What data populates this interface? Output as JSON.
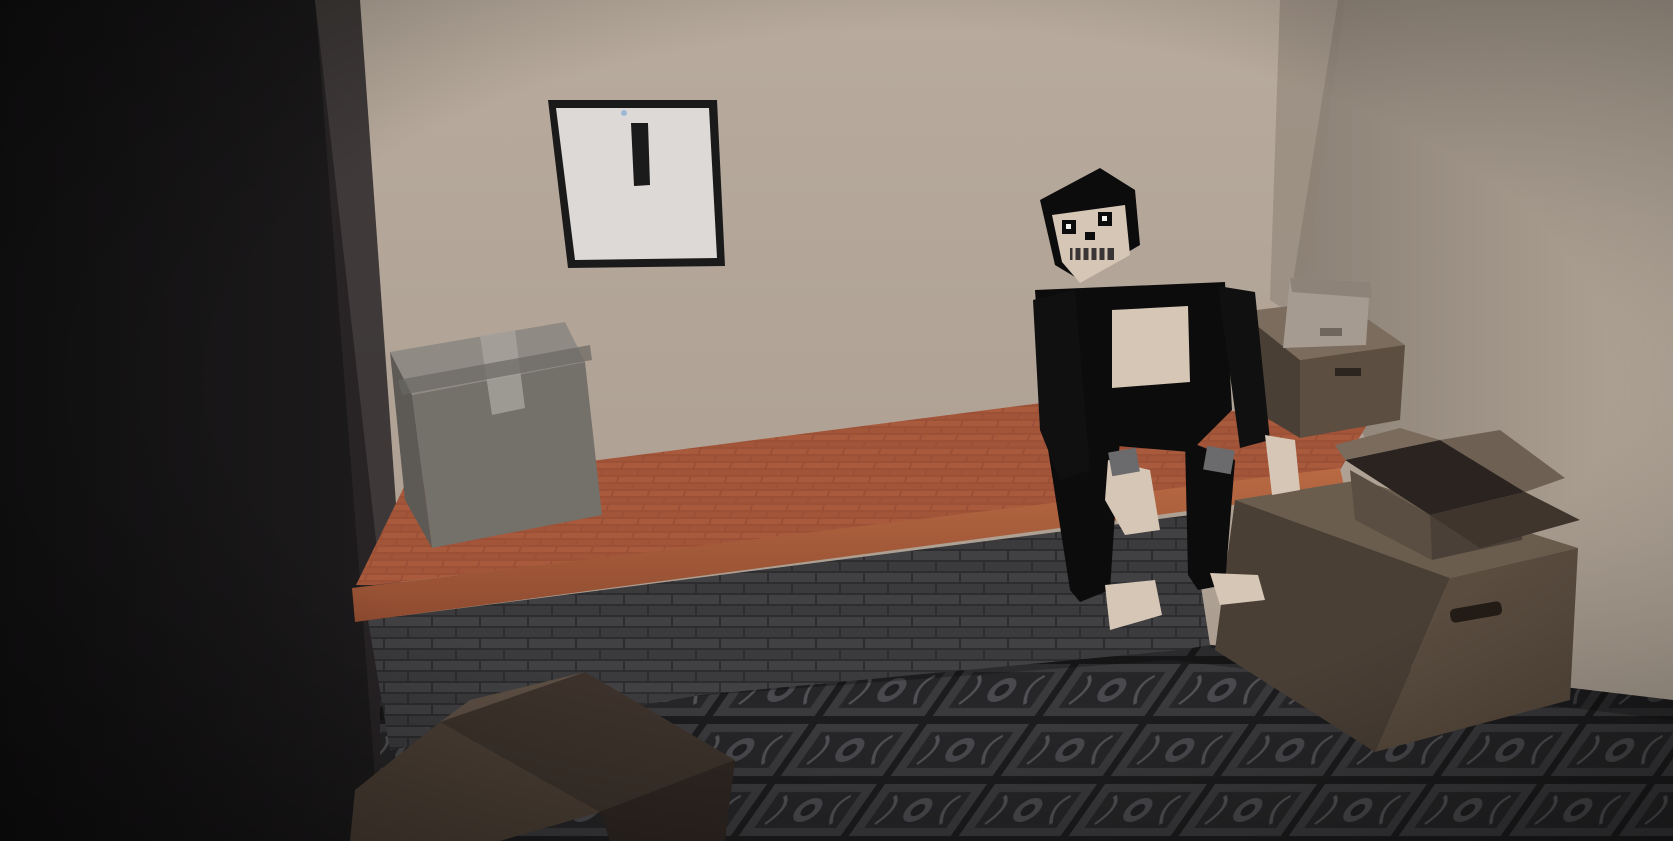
{
  "scene": {
    "poster": {
      "glyph": "I"
    },
    "colors": {
      "back_wall": "#b3a597",
      "right_wall": "#a2968a",
      "left_wall": "#161516",
      "shelf_top": "#9a4f35",
      "shelf_front": "#b4653e",
      "brick_side": "#3a393b",
      "floor_tile": "#2b2b2d",
      "box_grey": "#74706a",
      "box_brown": "#4a3f35",
      "character_suit": "#0d0c0d",
      "character_skin": "#d6c6b6"
    },
    "objects": [
      "poster-frame",
      "grey-cardboard-box",
      "brick-shelf",
      "animatronic-character",
      "stacked-boxes-right",
      "open-cardboard-box",
      "brown-box-corner",
      "ornate-floor-tiles"
    ]
  }
}
